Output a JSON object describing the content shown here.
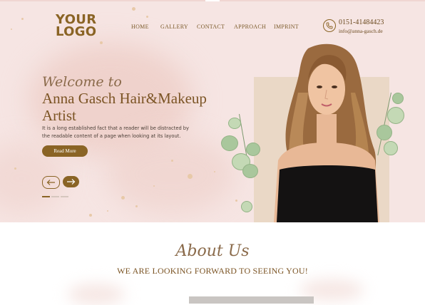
{
  "logo": {
    "line1": "YOUR",
    "line2": "LOGO"
  },
  "nav": {
    "home": "HOME",
    "gallery": "GALLERY",
    "contact": "CONTACT",
    "approach": "APPROACH",
    "imprint": "IMPRINT"
  },
  "contact_info": {
    "phone": "0151-41484423",
    "email": "info@anna-gasch.de",
    "icon": "phone-icon"
  },
  "hero": {
    "welcome": "Welcome to",
    "headline": "Anna Gasch Hair&Makeup Artist",
    "description": "It is a long established fact that a reader will be distracted by the readable content of a page when looking at its layout.",
    "button_label": "Read More",
    "prev_icon": "arrow-left-icon",
    "next_icon": "arrow-right-icon",
    "slides": 3,
    "active_slide": 1
  },
  "about": {
    "title": "About Us",
    "subtitle": "WE ARE LOOKING FORWARD TO SEEING YOU!"
  },
  "colors": {
    "brand": "#8a6425",
    "hero_background": "#f6e5e3",
    "photo_panel": "#ead8c6"
  }
}
